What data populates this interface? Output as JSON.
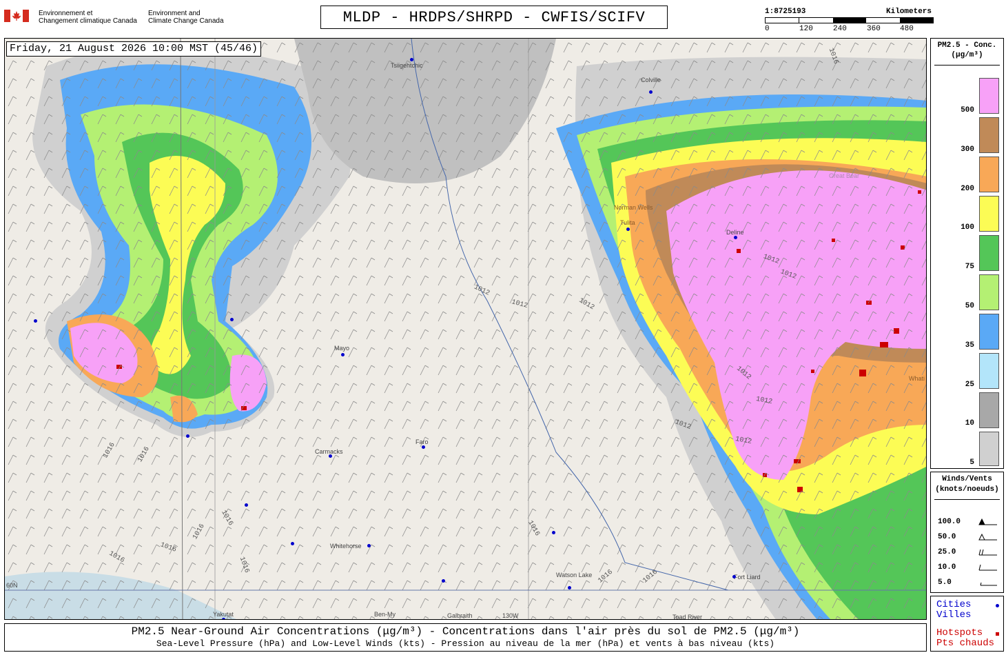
{
  "header": {
    "gov_fr": [
      "Environnement et",
      "Changement climatique Canada"
    ],
    "gov_en": [
      "Environment and",
      "Climate Change Canada"
    ],
    "title": "MLDP - HRDPS/SHRPD - CWFIS/SCIFV",
    "scale_ratio": "1:8725193",
    "scale_units": "Kilometers",
    "scale_ticks": [
      "0",
      "120",
      "240",
      "360",
      "480"
    ]
  },
  "map": {
    "timestamp": "Friday, 21 August 2026 10:00 MST (45/46)",
    "cities": [
      "Tsiigehtchic",
      "Colville",
      "Norman Wells",
      "Tulita",
      "Deline",
      "Great Bear",
      "Mayo",
      "Carmacks",
      "Faro",
      "Whitehorse",
      "Watson Lake",
      "Fort Liard",
      "Yakutat",
      "Ben-My",
      "Galbraith",
      "Toad River",
      "Whati",
      "60N",
      "130W"
    ],
    "isobars": [
      "1016",
      "1012",
      "1012",
      "1012",
      "1012",
      "1012",
      "1012",
      "1012",
      "1012",
      "1012",
      "1016",
      "1016",
      "1016",
      "1016",
      "1016",
      "1016",
      "1016",
      "1016",
      "1016",
      "1016"
    ]
  },
  "legend_pm": {
    "title": [
      "PM2.5 - Conc.",
      "(μg/m³)"
    ],
    "levels": [
      {
        "value": "500",
        "color": "#f7a1f7"
      },
      {
        "value": "300",
        "color": "#c08a58"
      },
      {
        "value": "200",
        "color": "#f8a857"
      },
      {
        "value": "100",
        "color": "#fcfc55"
      },
      {
        "value": "75",
        "color": "#54c658"
      },
      {
        "value": "50",
        "color": "#b4f073"
      },
      {
        "value": "35",
        "color": "#5aa9f6"
      },
      {
        "value": "25",
        "color": "#b3e5fa"
      },
      {
        "value": "10",
        "color": "#a8a8a8"
      },
      {
        "value": "5",
        "color": "#d0d0d0"
      }
    ]
  },
  "legend_wind": {
    "title": [
      "Winds/Vents",
      "(knots/noeuds)"
    ],
    "rows": [
      "100.0",
      "50.0",
      "25.0",
      "10.0",
      "5.0"
    ]
  },
  "legend_sym": {
    "cities": [
      "Cities",
      "Villes"
    ],
    "hotspots": [
      "Hotspots",
      "Pts chauds"
    ],
    "cities_color": "#0000cc",
    "hotspots_color": "#cc0000"
  },
  "footer": {
    "main": "PM2.5 Near-Ground Air Concentrations (μg/m³) - Concentrations dans l'air près du sol de PM2.5 (μg/m³)",
    "sub": "Sea-Level Pressure (hPa) and Low-Level Winds (kts) - Pression au niveau de la mer (hPa) et vents à bas niveau (kts)"
  }
}
